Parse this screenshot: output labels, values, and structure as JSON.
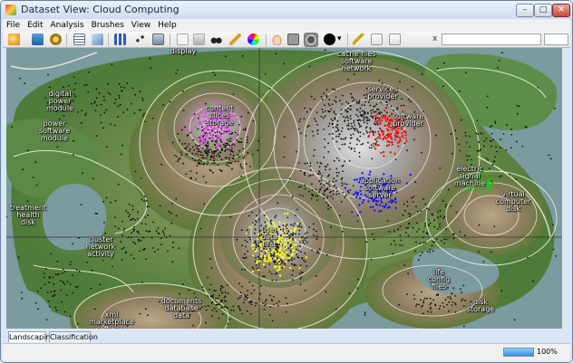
{
  "window": {
    "title": "Dataset View: Cloud Computing",
    "min_glyph": "–",
    "max_glyph": "□",
    "close_glyph": "✕"
  },
  "menu": [
    {
      "key": "file",
      "label": "File"
    },
    {
      "key": "edit",
      "label": "Edit"
    },
    {
      "key": "analysis",
      "label": "Analysis"
    },
    {
      "key": "brushes",
      "label": "Brushes"
    },
    {
      "key": "view",
      "label": "View"
    },
    {
      "key": "help",
      "label": "Help"
    }
  ],
  "toolbar": {
    "icons": [
      "open-icon",
      "save-icon",
      "gear-icon",
      "table-icon",
      "chart-icon",
      "bar-chart-icon",
      "scatter-icon",
      "landscape-icon",
      "copy-icon",
      "print-icon",
      "binoculars-icon",
      "paint-brush-icon",
      "color-wheel-icon",
      "hand-icon",
      "square-icon",
      "circle-brush-icon",
      "color-swatch-icon",
      "chevron-down-icon",
      "key-icon",
      "add-icon",
      "edit-icon"
    ],
    "clear_glyph": "x",
    "search_value": "",
    "search_placeholder": ""
  },
  "labels": [
    {
      "id": "display",
      "text": "display"
    },
    {
      "id": "cache",
      "text": "cache files\nsoftware\nnetwork"
    },
    {
      "id": "digital",
      "text": "digital\npower\nmodule"
    },
    {
      "id": "content",
      "text": "content\nslices\nstorage"
    },
    {
      "id": "services",
      "text": "services\nprovider"
    },
    {
      "id": "sftw",
      "text": "software\nprovider"
    },
    {
      "id": "power",
      "text": "power\nsoftware\nmodule"
    },
    {
      "id": "electric",
      "text": "electric\nsignal\nmachine"
    },
    {
      "id": "application",
      "text": "application\nsoftware\nserver"
    },
    {
      "id": "virtual",
      "text": "virtual\ncomputer\ndisk"
    },
    {
      "id": "treatment",
      "text": "treatment\nhealth\ndisk"
    },
    {
      "id": "user",
      "text": "user\ndata\nfirst"
    },
    {
      "id": "cluster",
      "text": "cluster\nnetwork\nactivity"
    },
    {
      "id": "life",
      "text": "life\nconfig\nfiles"
    },
    {
      "id": "documents",
      "text": "documents\ndatabase\ndata"
    },
    {
      "id": "disk",
      "text": "disk\nstorage"
    },
    {
      "id": "xml",
      "text": "xml\nmarketplace\nsoftware"
    }
  ],
  "colors": {
    "pink": "#ff33ff",
    "red": "#ff1111",
    "blue": "#1a1aff",
    "yellow": "#ffff00",
    "green": "#11cc11",
    "water": "#7b9b9f"
  },
  "tabs": [
    {
      "key": "landscaping",
      "label": "Landscaping"
    },
    {
      "key": "classification",
      "label": "Classification"
    }
  ],
  "status": {
    "progress": 100,
    "progress_label": "100%"
  }
}
